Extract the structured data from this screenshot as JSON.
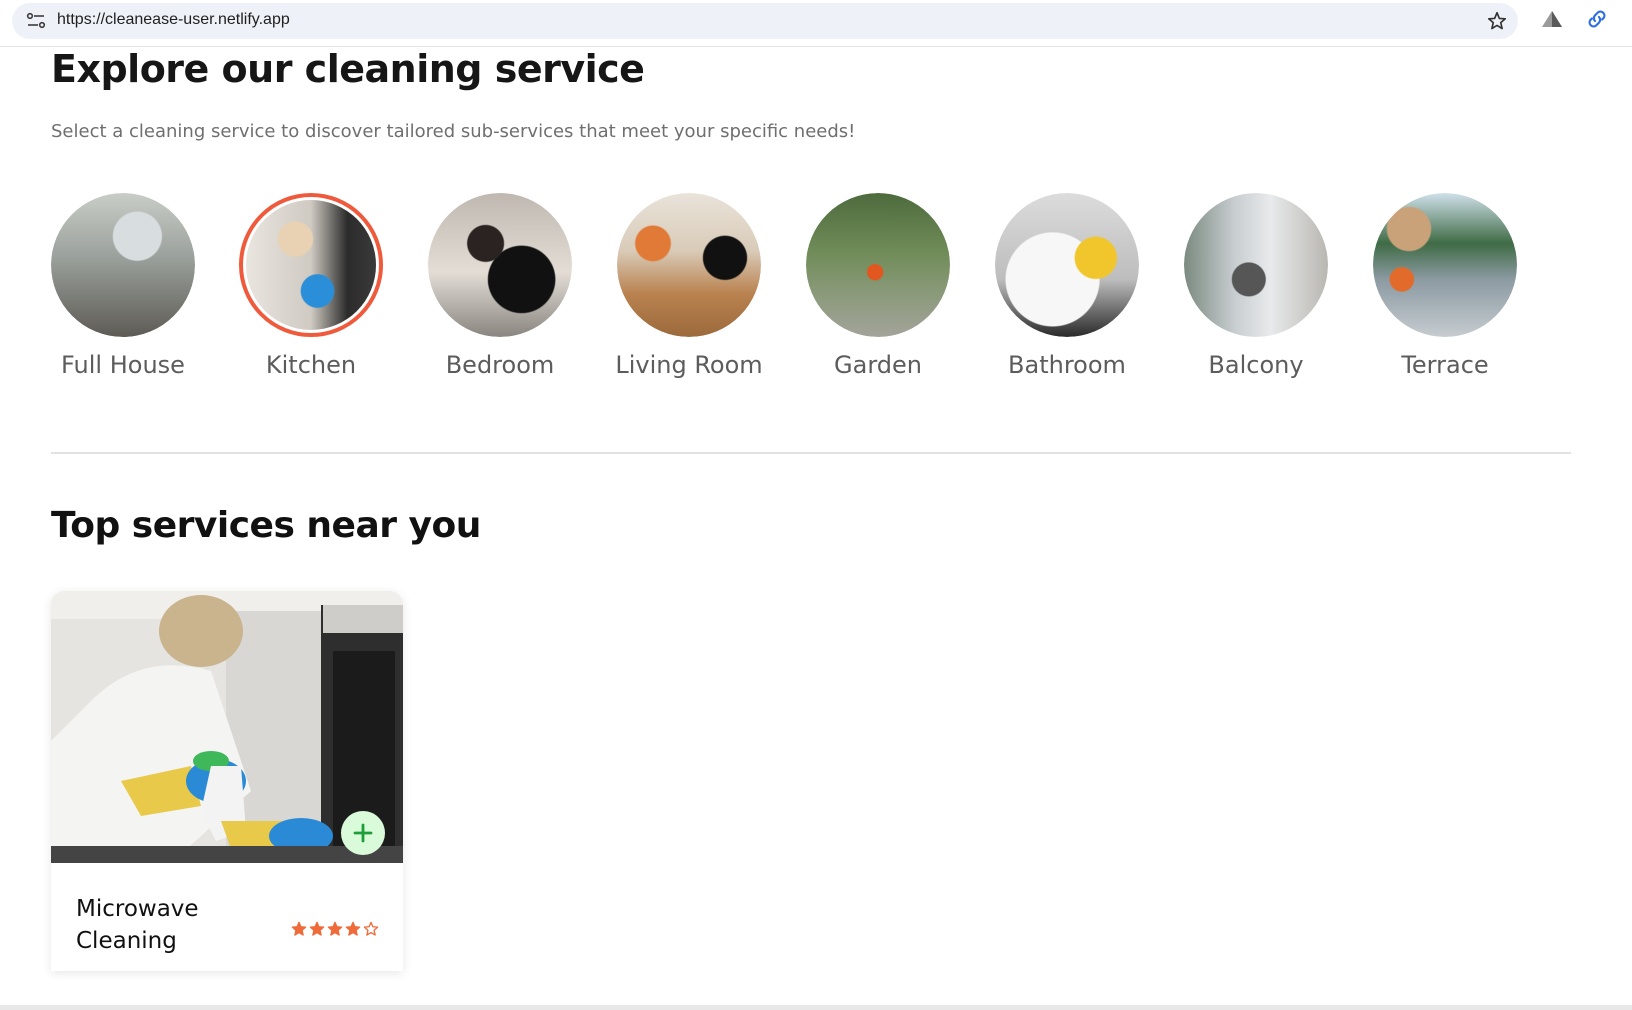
{
  "browser": {
    "url": "https://cleanease-user.netlify.app"
  },
  "page": {
    "title": "Explore our cleaning service",
    "subtitle": "Select a cleaning service to discover tailored sub-services that meet your specific needs!"
  },
  "categories": [
    {
      "label": "Full House",
      "selected": false
    },
    {
      "label": "Kitchen",
      "selected": true
    },
    {
      "label": "Bedroom",
      "selected": false
    },
    {
      "label": "Living Room",
      "selected": false
    },
    {
      "label": "Garden",
      "selected": false
    },
    {
      "label": "Bathroom",
      "selected": false
    },
    {
      "label": "Balcony",
      "selected": false
    },
    {
      "label": "Terrace",
      "selected": false
    }
  ],
  "top_services": {
    "title": "Top services near you",
    "cards": [
      {
        "title": "Microwave Cleaning",
        "rating": 4,
        "rating_max": 5
      }
    ]
  },
  "colors": {
    "accent": "#ef5a3c",
    "rating_star": "#ef6b3a",
    "add_button_bg": "#d9fbd9",
    "add_button_icon": "#1f9d3a"
  }
}
